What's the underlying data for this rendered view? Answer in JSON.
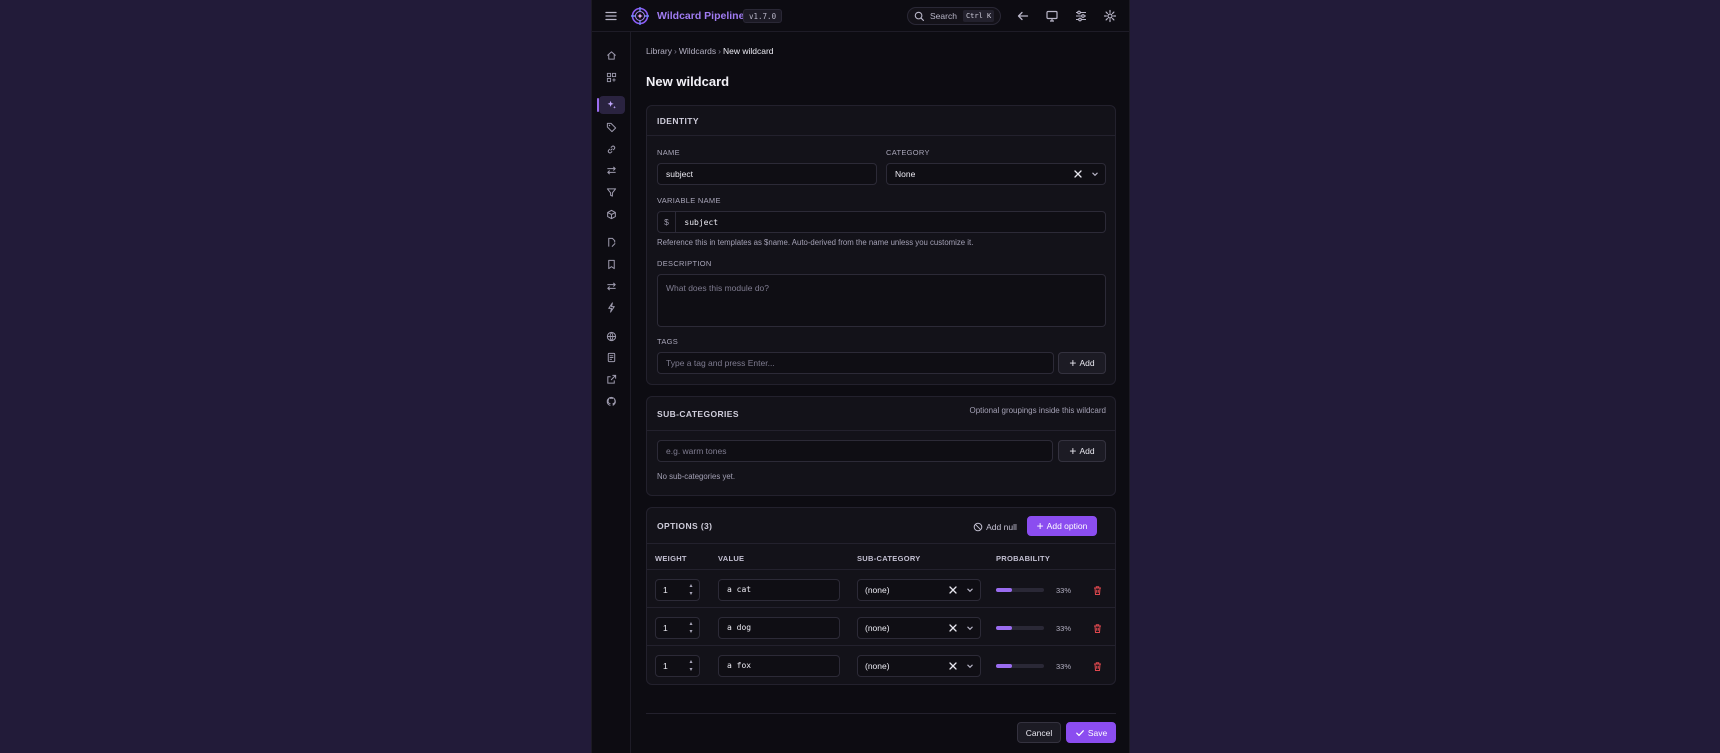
{
  "app": {
    "title": "Wildcard Pipeline",
    "version": "v1.7.0"
  },
  "search": {
    "label": "Search",
    "shortcut": "Ctrl K"
  },
  "breadcrumb": {
    "items": [
      "Library",
      "Wildcards"
    ],
    "current": "New wildcard",
    "separator": "›"
  },
  "page": {
    "title": "New wildcard"
  },
  "identity": {
    "heading": "IDENTITY",
    "name_label": "NAME",
    "name_value": "subject",
    "category_label": "CATEGORY",
    "category_value": "None",
    "variable_label": "VARIABLE NAME",
    "variable_prefix": "$",
    "variable_value": "subject",
    "variable_help": "Reference this in templates as $name. Auto-derived from the name unless you customize it.",
    "description_label": "DESCRIPTION",
    "description_placeholder": "What does this module do?",
    "tags_label": "TAGS",
    "tags_placeholder": "Type a tag and press Enter...",
    "add_label": "Add"
  },
  "subcategories": {
    "heading": "SUB-CATEGORIES",
    "note": "Optional groupings inside this wildcard",
    "placeholder": "e.g. warm tones",
    "add_label": "Add",
    "empty": "No sub-categories yet."
  },
  "options": {
    "heading": "OPTIONS (3)",
    "add_null_label": "Add null",
    "add_option_label": "Add option",
    "columns": [
      "WEIGHT",
      "VALUE",
      "SUB-CATEGORY",
      "PROBABILITY"
    ],
    "rows": [
      {
        "weight": "1",
        "value": "a cat",
        "subcategory": "(none)",
        "probability": 0.33,
        "probability_label": "33%"
      },
      {
        "weight": "1",
        "value": "a dog",
        "subcategory": "(none)",
        "probability": 0.33,
        "probability_label": "33%"
      },
      {
        "weight": "1",
        "value": "a fox",
        "subcategory": "(none)",
        "probability": 0.33,
        "probability_label": "33%"
      }
    ]
  },
  "footer": {
    "cancel_label": "Cancel",
    "save_label": "Save"
  },
  "colors": {
    "accent": "#8b4df0",
    "background": "#221b39",
    "panel": "#0d0c12",
    "danger": "#e0484e"
  }
}
